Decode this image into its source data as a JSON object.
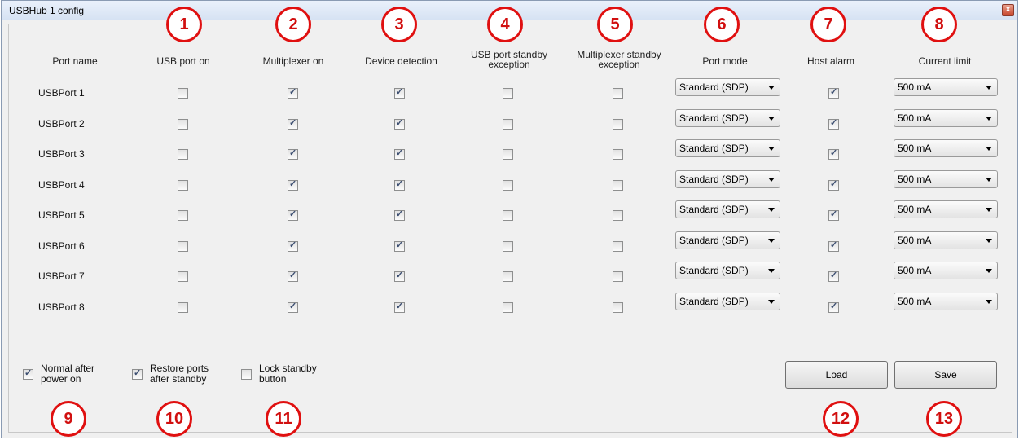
{
  "window": {
    "title": "USBHub 1 config",
    "close_label": "x"
  },
  "columns": {
    "port_name": "Port name",
    "usb_port_on": "USB port on",
    "multiplexer_on": "Multiplexer on",
    "device_detection": "Device detection",
    "usb_standby_exception": [
      "USB port standby",
      "exception"
    ],
    "mux_standby_exception": [
      "Multiplexer standby",
      "exception"
    ],
    "port_mode": "Port mode",
    "host_alarm": "Host alarm",
    "current_limit": "Current limit"
  },
  "ports": [
    {
      "name": "USBPort 1",
      "usb_on": false,
      "mux_on": true,
      "detect": true,
      "usb_exc": false,
      "mux_exc": false,
      "mode": "Standard (SDP)",
      "alarm": true,
      "limit": "500 mA"
    },
    {
      "name": "USBPort 2",
      "usb_on": false,
      "mux_on": true,
      "detect": true,
      "usb_exc": false,
      "mux_exc": false,
      "mode": "Standard (SDP)",
      "alarm": true,
      "limit": "500 mA"
    },
    {
      "name": "USBPort 3",
      "usb_on": false,
      "mux_on": true,
      "detect": true,
      "usb_exc": false,
      "mux_exc": false,
      "mode": "Standard (SDP)",
      "alarm": true,
      "limit": "500 mA"
    },
    {
      "name": "USBPort 4",
      "usb_on": false,
      "mux_on": true,
      "detect": true,
      "usb_exc": false,
      "mux_exc": false,
      "mode": "Standard (SDP)",
      "alarm": true,
      "limit": "500 mA"
    },
    {
      "name": "USBPort 5",
      "usb_on": false,
      "mux_on": true,
      "detect": true,
      "usb_exc": false,
      "mux_exc": false,
      "mode": "Standard (SDP)",
      "alarm": true,
      "limit": "500 mA"
    },
    {
      "name": "USBPort 6",
      "usb_on": false,
      "mux_on": true,
      "detect": true,
      "usb_exc": false,
      "mux_exc": false,
      "mode": "Standard (SDP)",
      "alarm": true,
      "limit": "500 mA"
    },
    {
      "name": "USBPort 7",
      "usb_on": false,
      "mux_on": true,
      "detect": true,
      "usb_exc": false,
      "mux_exc": false,
      "mode": "Standard (SDP)",
      "alarm": true,
      "limit": "500 mA"
    },
    {
      "name": "USBPort 8",
      "usb_on": false,
      "mux_on": true,
      "detect": true,
      "usb_exc": false,
      "mux_exc": false,
      "mode": "Standard (SDP)",
      "alarm": true,
      "limit": "500 mA"
    }
  ],
  "options": {
    "normal_after_power_on": {
      "label": [
        "Normal after",
        "power on"
      ],
      "checked": true
    },
    "restore_ports_after_standby": {
      "label": [
        "Restore ports",
        "after standby"
      ],
      "checked": true
    },
    "lock_standby_button": {
      "label": [
        "Lock standby",
        "button"
      ],
      "checked": false
    }
  },
  "buttons": {
    "load": "Load",
    "save": "Save"
  },
  "callouts": [
    "1",
    "2",
    "3",
    "4",
    "5",
    "6",
    "7",
    "8",
    "9",
    "10",
    "11",
    "12",
    "13"
  ],
  "colors": {
    "callout": "#e01010",
    "window_bg": "#f0f0f0"
  }
}
